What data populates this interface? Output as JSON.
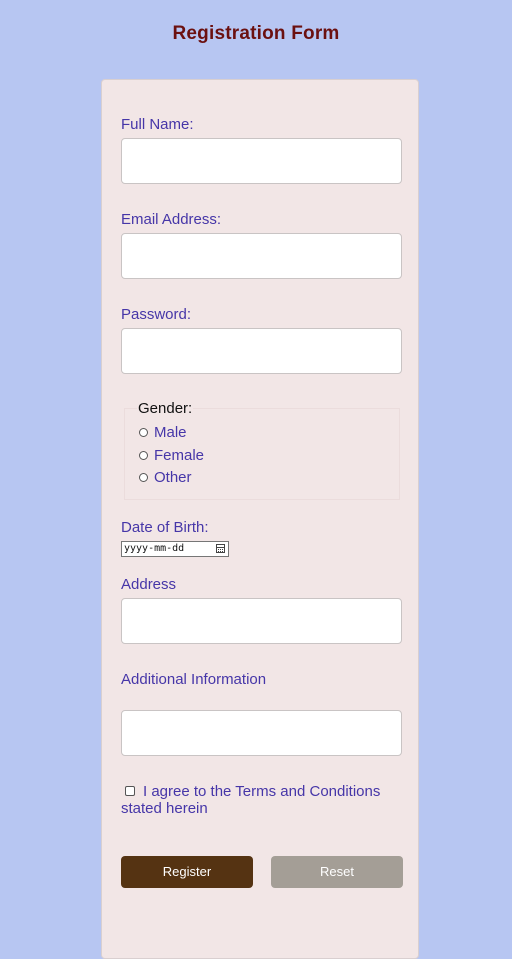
{
  "page": {
    "title": "Registration Form"
  },
  "form": {
    "full_name_label": "Full Name:",
    "full_name_value": "",
    "email_label": "Email Address:",
    "email_value": "",
    "password_label": "Password:",
    "password_value": "",
    "gender": {
      "legend": "Gender:",
      "options": [
        "Male",
        "Female",
        "Other"
      ]
    },
    "dob_label": "Date of Birth:",
    "dob_placeholder": "yyyy-mm-dd",
    "address_label": "Address",
    "address_value": "",
    "additional_label": "Additional Information",
    "additional_value": "",
    "terms_text": "I agree to the Terms and Conditions stated herein",
    "register_label": "Register",
    "reset_label": "Reset"
  },
  "colors": {
    "background": "#b7c6f2",
    "card": "#f2e6e6",
    "title": "#6b1010",
    "label": "#4636a8",
    "register_button": "#553312",
    "reset_button": "#a49e96"
  }
}
